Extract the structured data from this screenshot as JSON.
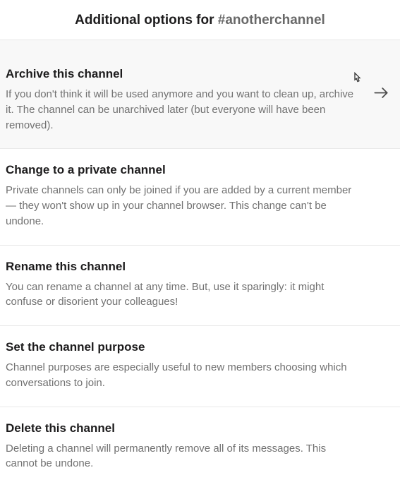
{
  "header": {
    "prefix": "Additional options for ",
    "channel": "#anotherchannel"
  },
  "options": [
    {
      "title": "Archive this channel",
      "description": "If you don't think it will be used anymore and you want to clean up, archive it. The channel can be unarchived later (but everyone will have been removed)."
    },
    {
      "title": "Change to a private channel",
      "description": "Private channels can only be joined if you are added by a current member — they won't show up in your channel browser. This change can't be undone."
    },
    {
      "title": "Rename this channel",
      "description": "You can rename a channel at any time. But, use it sparingly: it might confuse or disorient your colleagues!"
    },
    {
      "title": "Set the channel purpose",
      "description": "Channel purposes are especially useful to new members choosing which conversations to join."
    },
    {
      "title": "Delete this channel",
      "description": "Deleting a channel will permanently remove all of its messages. This cannot be undone."
    }
  ]
}
